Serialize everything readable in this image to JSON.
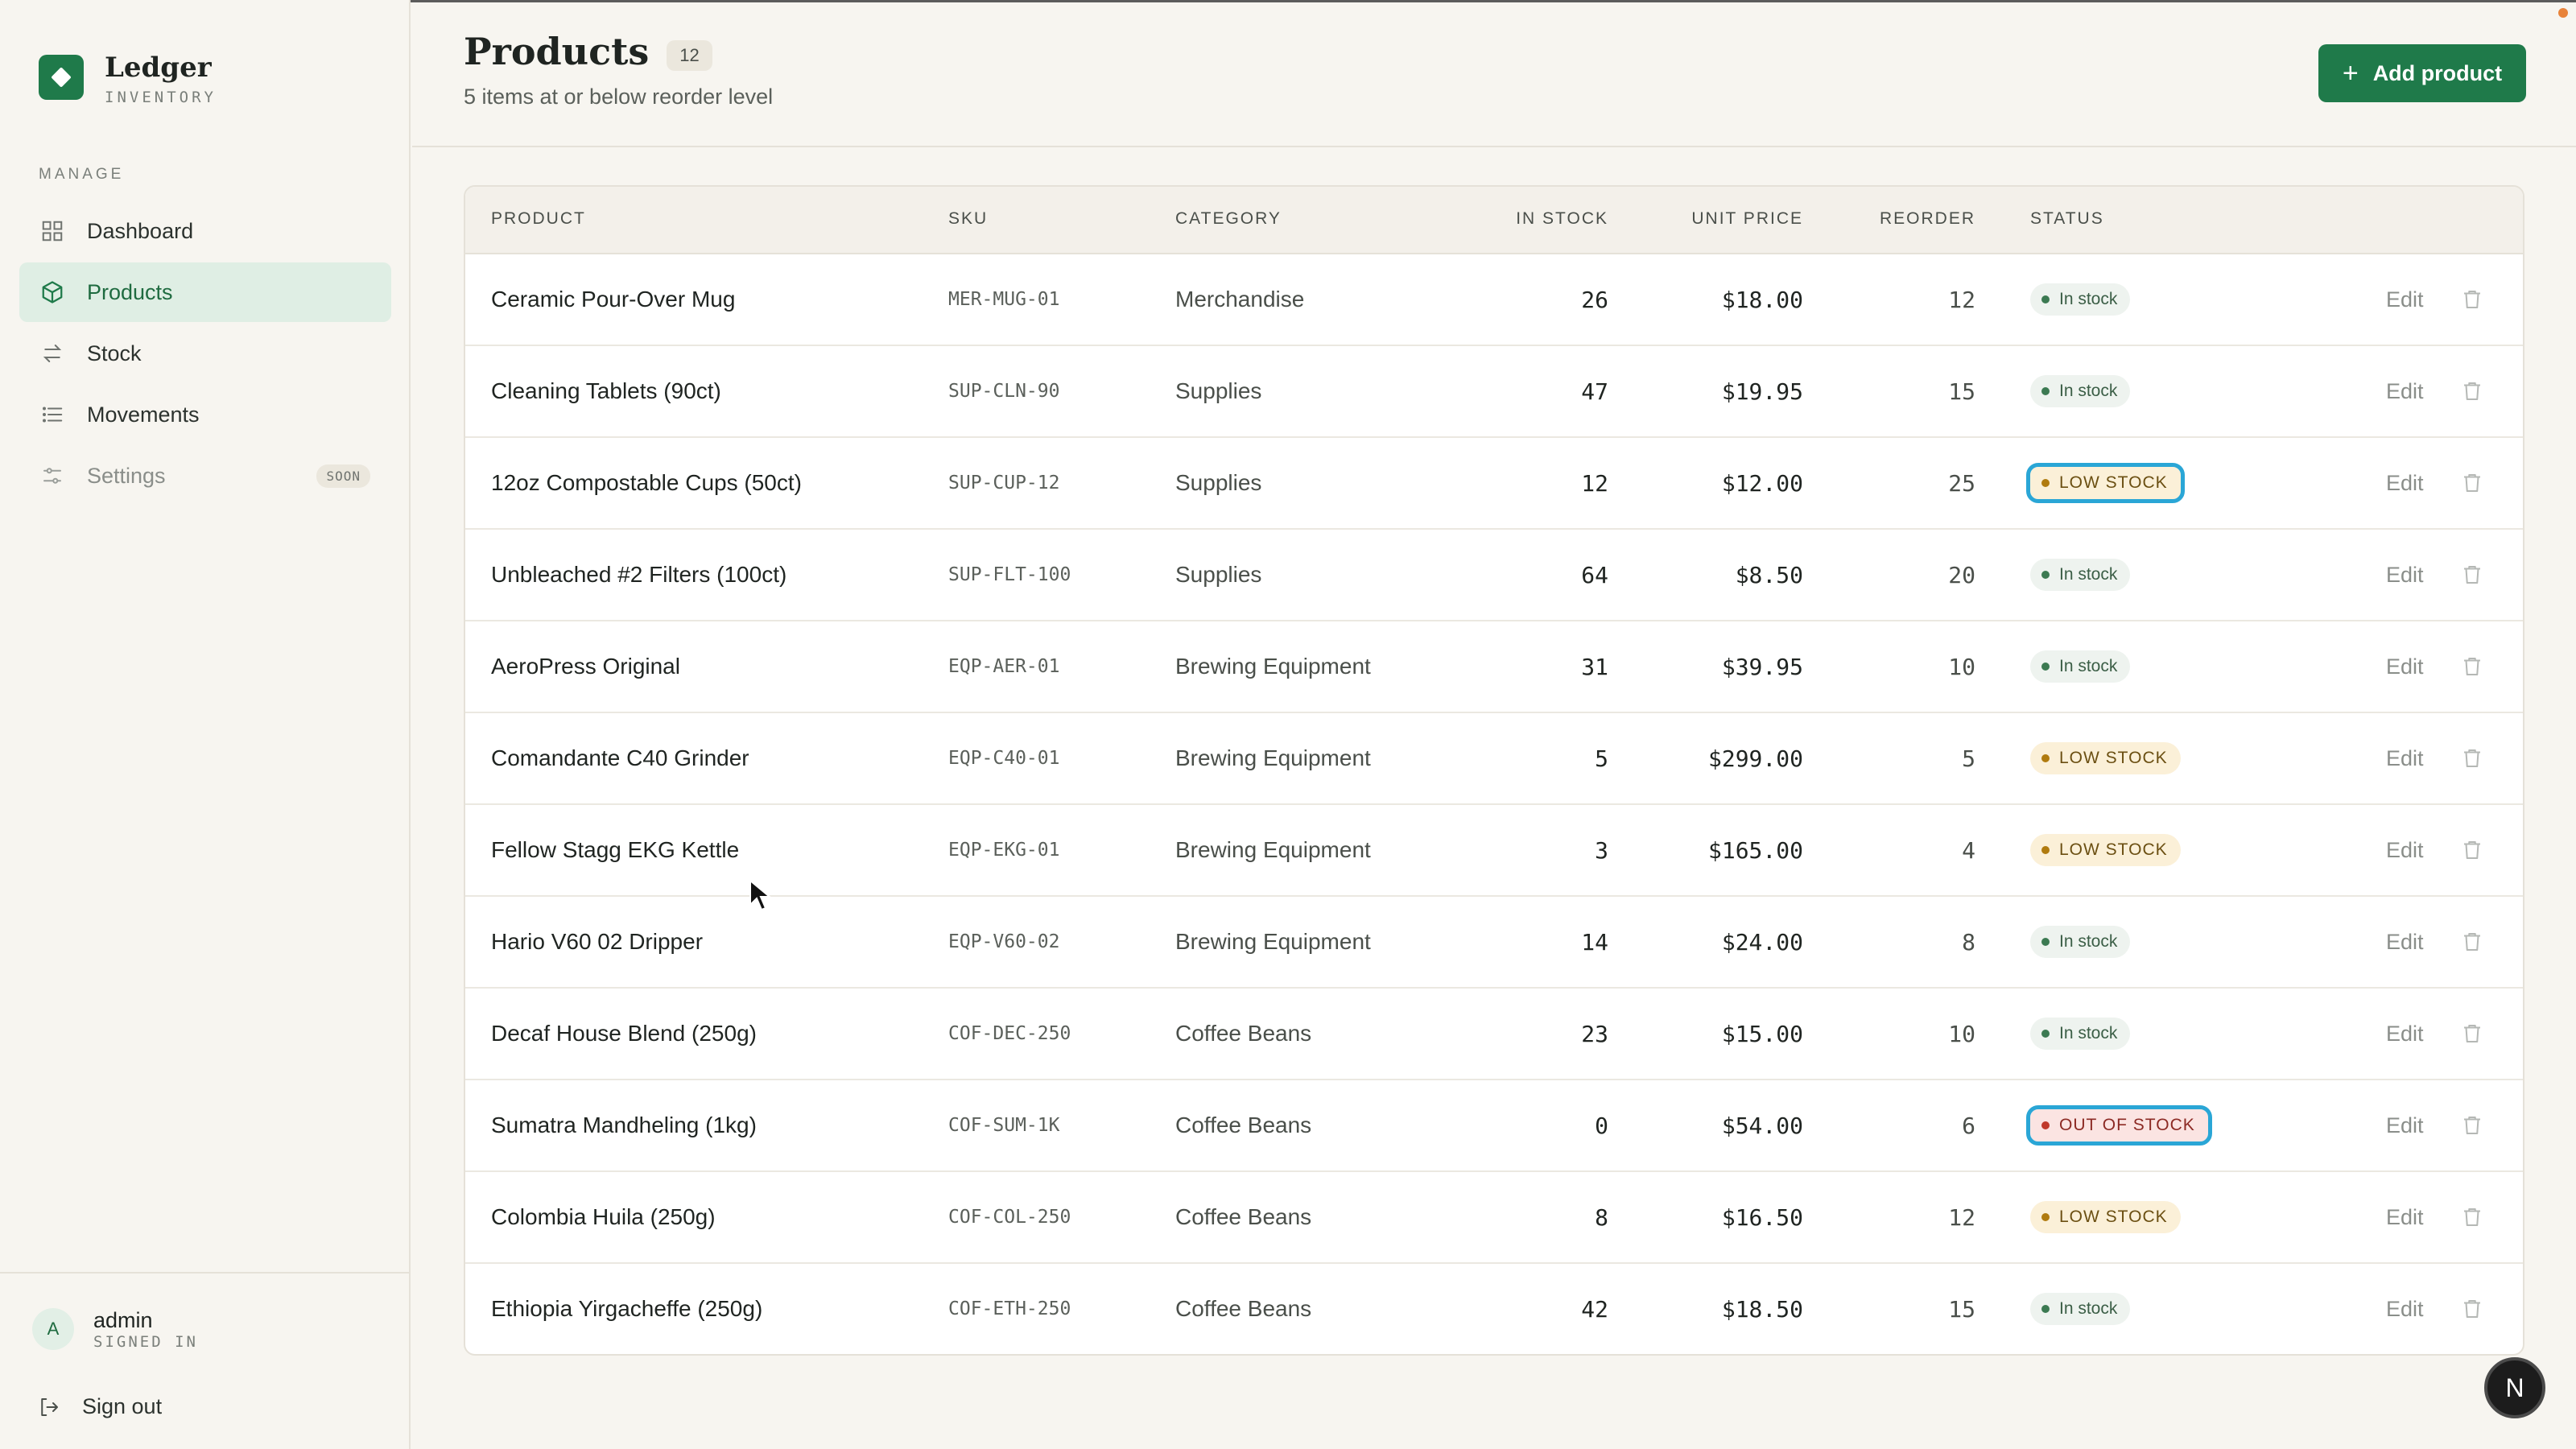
{
  "brand": {
    "name": "Ledger",
    "subtitle": "INVENTORY"
  },
  "sidebar": {
    "section_label": "MANAGE",
    "items": [
      {
        "label": "Dashboard",
        "icon": "grid-icon",
        "active": false
      },
      {
        "label": "Products",
        "icon": "box-icon",
        "active": true
      },
      {
        "label": "Stock",
        "icon": "swap-icon",
        "active": false
      },
      {
        "label": "Movements",
        "icon": "list-icon",
        "active": false
      },
      {
        "label": "Settings",
        "icon": "sliders-icon",
        "active": false,
        "badge": "SOON"
      }
    ]
  },
  "user": {
    "initial": "A",
    "name": "admin",
    "status": "SIGNED IN",
    "signout_label": "Sign out"
  },
  "header": {
    "title": "Products",
    "count": "12",
    "subtitle": "5 items at or below reorder level",
    "add_button": "Add product"
  },
  "table": {
    "columns": {
      "product": "PRODUCT",
      "sku": "SKU",
      "category": "CATEGORY",
      "in_stock": "IN STOCK",
      "unit_price": "UNIT PRICE",
      "reorder": "REORDER",
      "status": "STATUS"
    },
    "edit_label": "Edit",
    "rows": [
      {
        "name": "Ceramic Pour-Over Mug",
        "sku": "MER-MUG-01",
        "category": "Merchandise",
        "stock": "26",
        "price": "$18.00",
        "reorder": "12",
        "status": "In stock"
      },
      {
        "name": "Cleaning Tablets (90ct)",
        "sku": "SUP-CLN-90",
        "category": "Supplies",
        "stock": "47",
        "price": "$19.95",
        "reorder": "15",
        "status": "In stock"
      },
      {
        "name": "12oz Compostable Cups (50ct)",
        "sku": "SUP-CUP-12",
        "category": "Supplies",
        "stock": "12",
        "price": "$12.00",
        "reorder": "25",
        "status": "LOW STOCK"
      },
      {
        "name": "Unbleached #2 Filters (100ct)",
        "sku": "SUP-FLT-100",
        "category": "Supplies",
        "stock": "64",
        "price": "$8.50",
        "reorder": "20",
        "status": "In stock"
      },
      {
        "name": "AeroPress Original",
        "sku": "EQP-AER-01",
        "category": "Brewing Equipment",
        "stock": "31",
        "price": "$39.95",
        "reorder": "10",
        "status": "In stock"
      },
      {
        "name": "Comandante C40 Grinder",
        "sku": "EQP-C40-01",
        "category": "Brewing Equipment",
        "stock": "5",
        "price": "$299.00",
        "reorder": "5",
        "status": "LOW STOCK"
      },
      {
        "name": "Fellow Stagg EKG Kettle",
        "sku": "EQP-EKG-01",
        "category": "Brewing Equipment",
        "stock": "3",
        "price": "$165.00",
        "reorder": "4",
        "status": "LOW STOCK"
      },
      {
        "name": "Hario V60 02 Dripper",
        "sku": "EQP-V60-02",
        "category": "Brewing Equipment",
        "stock": "14",
        "price": "$24.00",
        "reorder": "8",
        "status": "In stock"
      },
      {
        "name": "Decaf House Blend (250g)",
        "sku": "COF-DEC-250",
        "category": "Coffee Beans",
        "stock": "23",
        "price": "$15.00",
        "reorder": "10",
        "status": "In stock"
      },
      {
        "name": "Sumatra Mandheling (1kg)",
        "sku": "COF-SUM-1K",
        "category": "Coffee Beans",
        "stock": "0",
        "price": "$54.00",
        "reorder": "6",
        "status": "OUT OF STOCK"
      },
      {
        "name": "Colombia Huila (250g)",
        "sku": "COF-COL-250",
        "category": "Coffee Beans",
        "stock": "8",
        "price": "$16.50",
        "reorder": "12",
        "status": "LOW STOCK"
      },
      {
        "name": "Ethiopia Yirgacheffe (250g)",
        "sku": "COF-ETH-250",
        "category": "Coffee Beans",
        "stock": "42",
        "price": "$18.50",
        "reorder": "15",
        "status": "In stock"
      }
    ]
  },
  "fab": {
    "label": "N"
  },
  "colors": {
    "brand": "#1f7a4a",
    "low_stock": "#b07b0f",
    "out_of_stock": "#c0392b",
    "focus_ring": "#2aa6d6"
  }
}
